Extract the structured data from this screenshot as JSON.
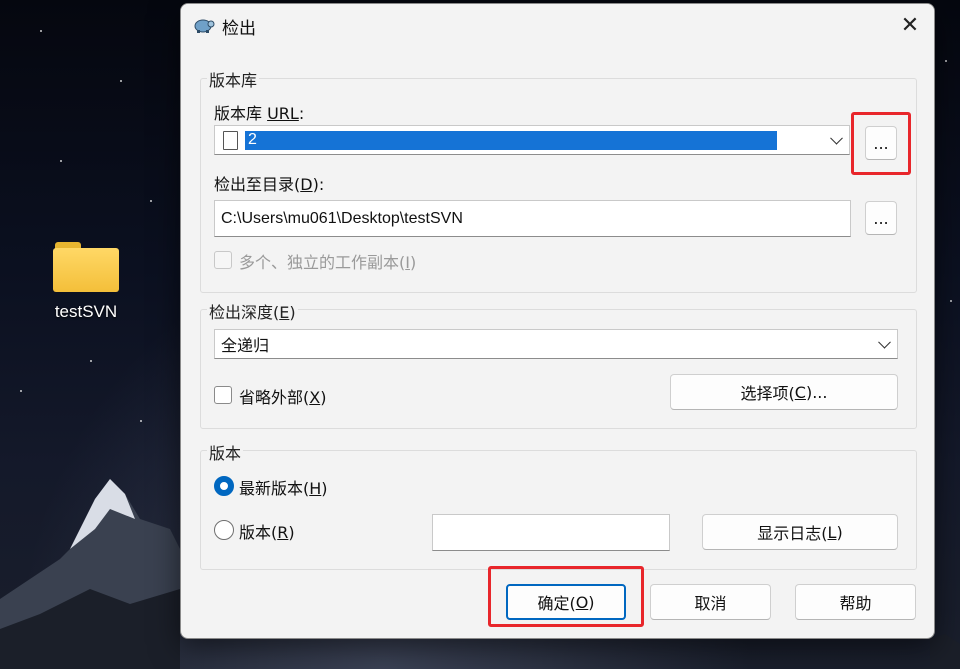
{
  "desktop": {
    "icon_label": "testSVN"
  },
  "dialog": {
    "title": "检出",
    "close_glyph": "✕",
    "repository_group": {
      "label": "版本库",
      "url_label_prefix": "版本库 ",
      "url_label_key": "URL",
      "url_label_suffix": ":",
      "url_value": "2",
      "browse_button": "...",
      "checkout_dir_label_prefix": "检出至目录(",
      "checkout_dir_label_key": "D",
      "checkout_dir_label_suffix": "):",
      "checkout_dir_value": "C:\\Users\\mu061\\Desktop\\testSVN",
      "browse_dir_button": "...",
      "multi_wc_label_prefix": "多个、独立的工作副本(",
      "multi_wc_label_key": "I",
      "multi_wc_label_suffix": ")",
      "multi_wc_checked": false
    },
    "depth_group": {
      "label_prefix": "检出深度(",
      "label_key": "E",
      "label_suffix": ")",
      "selected": "全递归",
      "omit_externals_prefix": "省略外部(",
      "omit_externals_key": "X",
      "omit_externals_suffix": ")",
      "omit_externals_checked": false,
      "options_button_prefix": "选择项(",
      "options_button_key": "C",
      "options_button_suffix": ")..."
    },
    "revision_group": {
      "label": "版本",
      "head_prefix": "最新版本(",
      "head_key": "H",
      "head_suffix": ")",
      "head_selected": true,
      "revision_prefix": "版本(",
      "revision_key": "R",
      "revision_suffix": ")",
      "revision_value": "",
      "show_log_prefix": "显示日志(",
      "show_log_key": "L",
      "show_log_suffix": ")"
    },
    "buttons": {
      "ok_prefix": "确定(",
      "ok_key": "O",
      "ok_suffix": ")",
      "cancel": "取消",
      "help": "帮助"
    },
    "colors": {
      "accent": "#0067c0",
      "highlight_box": "#e8262b",
      "selection": "#1573d6"
    }
  }
}
